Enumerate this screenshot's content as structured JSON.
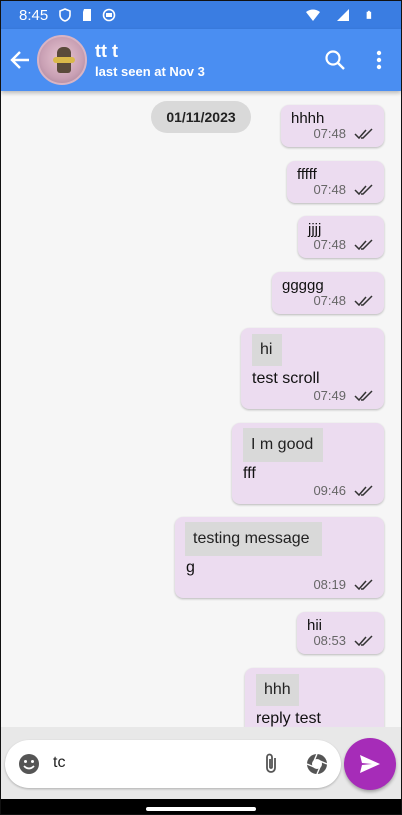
{
  "status_bar": {
    "time": "8:45"
  },
  "header": {
    "contact_name": "tt t",
    "last_seen": "last seen at Nov 3"
  },
  "chat": {
    "date_chip": "01/11/2023",
    "messages": [
      {
        "text": "hhhh",
        "time": "07:48"
      },
      {
        "text": "fffff",
        "time": "07:48"
      },
      {
        "text": "jjjj",
        "time": "07:48"
      },
      {
        "text": "ggggg",
        "time": "07:48"
      },
      {
        "reply": "hi",
        "text": "test scroll",
        "time": "07:49"
      },
      {
        "reply": "I m good",
        "text": "fff",
        "time": "09:46"
      },
      {
        "reply": "testing message",
        "text": "g",
        "time": "08:19"
      },
      {
        "text": "hii",
        "time": "08:53"
      },
      {
        "reply": "hhh",
        "text": "reply test",
        "time": ""
      }
    ]
  },
  "composer": {
    "value": "tc"
  },
  "colors": {
    "app_bar": "#4a8ef2",
    "status_bar": "#3a7de2",
    "bubble": "#ecdcf0",
    "send_button": "#a62cb8"
  }
}
